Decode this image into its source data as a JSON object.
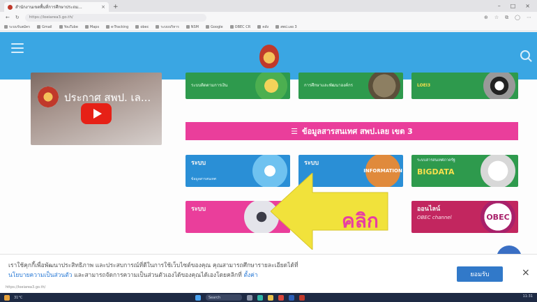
{
  "browser": {
    "tab_title": "สำนักงานเขตพื้นที่การศึกษาประถม...",
    "url": "https://loeiarea3.go.th/",
    "bookmarks": [
      "ระบบรับสมัคร",
      "Gmail",
      "YouTube",
      "Maps",
      "e-Tracking",
      "obec",
      "ระบบบริหาร",
      "NSM",
      "Google",
      "OBEC CR",
      "คลัง",
      "สพป.เลย 3"
    ]
  },
  "site": {
    "video_title": "ประกาศ สพป. เล...",
    "section_title": "ข้อมูลสารสนเทศ สพป.เลย เขต 3",
    "banners": {
      "top_left": "ระบบติดตามการเงิน",
      "top_mid": "การศึกษาและพัฒนาองค์กร",
      "top_right": "LOEI3"
    },
    "systems": {
      "sys1_title": "ระบบ",
      "sys1_sub": "ข้อมูลสารสนเทศ",
      "sys2_title": "ระบบ",
      "sys2_center": "INFORMATION",
      "sys3_title": "ระบบสารสนเทศภาครัฐ",
      "sys3_center": "BIGDATA",
      "sys4_title": "ระบบ",
      "sys5_title": "ออนไลน์",
      "sys5_center": "OBEC channel",
      "sys5_badge": "OBEC"
    }
  },
  "overlay": {
    "arrow_label": "คลิก"
  },
  "cookie": {
    "line1": "เราใช้คุกกี้เพื่อพัฒนาประสิทธิภาพ และประสบการณ์ที่ดีในการใช้เว็บไซต์ของคุณ คุณสามารถศึกษารายละเอียดได้ที่",
    "policy_link": "นโยบายความเป็นส่วนตัว",
    "line2_mid": "และสามารถจัดการความเป็นส่วนตัวเองได้ของคุณได้เองโดยคลิกที่",
    "settings_link": "ตั้งค่า",
    "accept_label": "ยอมรับ",
    "close_label": "×",
    "status_url": "https://loeiarea3.go.th/"
  },
  "taskbar": {
    "weather": "31°C",
    "search": "Search",
    "clock": "11:31"
  },
  "colors": {
    "header_blue": "#3aa6e3",
    "section_pink": "#ea3e9b",
    "arrow_yellow": "#f1e23b",
    "accept_blue": "#3179c9"
  }
}
